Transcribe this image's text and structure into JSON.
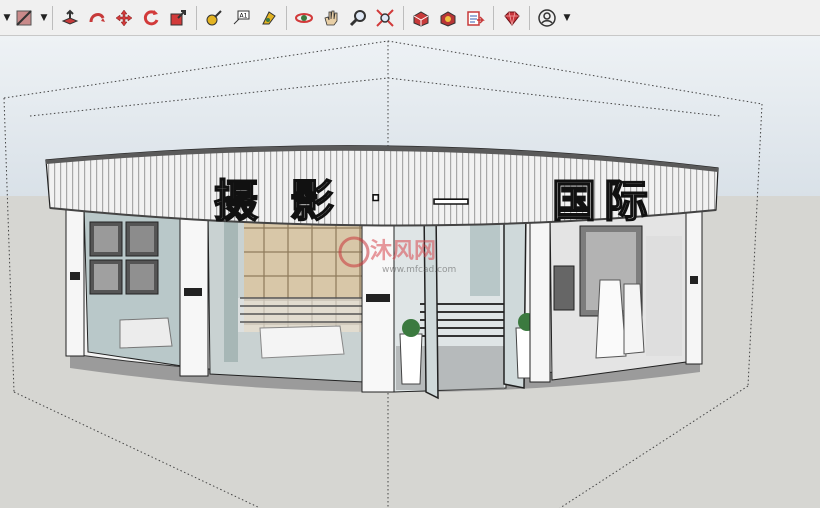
{
  "toolbar": {
    "groups": [
      [
        "style-dropdown",
        "paint-bucket",
        "style-dropdown-arrow"
      ],
      [
        "push-pull",
        "follow-me",
        "move",
        "rotate",
        "scale"
      ],
      [
        "tape-measure",
        "text-label",
        "paint"
      ],
      [
        "orbit",
        "pan",
        "zoom",
        "zoom-extents"
      ],
      [
        "warehouse",
        "extension-warehouse",
        "layout"
      ],
      [
        "ruby-console"
      ],
      [
        "account",
        "account-dropdown-arrow"
      ]
    ]
  },
  "scene": {
    "sign_chars": [
      "摄",
      "影",
      "·",
      "—",
      "国",
      "际"
    ],
    "watermark_main": "沐风网",
    "watermark_sub": "www.mfcad.com",
    "colors": {
      "sky": "#dfe6ed",
      "ground": "#d7d7d2",
      "facade": "#f4f4f4",
      "glass": "#b8c6c8",
      "wood": "#d8c7a8",
      "accent_red": "#c8343b",
      "accent_green": "#3b7a3f"
    }
  }
}
